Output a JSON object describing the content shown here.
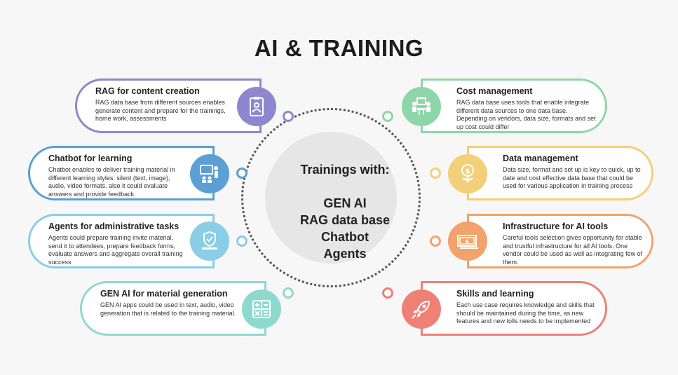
{
  "title": "AI & TRAINING",
  "center": {
    "heading": "Trainings with:",
    "items": [
      "GEN AI",
      "RAG data base",
      "Chatbot",
      "Agents"
    ]
  },
  "colors": {
    "purple": "#8e87cf",
    "blue": "#5b9fd4",
    "light_blue": "#89cde6",
    "teal": "#8fd8cd",
    "green": "#8ed6a9",
    "yellow": "#f2cf79",
    "orange": "#f1a36b",
    "red": "#ee8076"
  },
  "cards": {
    "rag": {
      "title": "RAG for content creation",
      "text": "RAG data base from different sources enables generate content and prepare for the trainings, home work, assessments",
      "icon": "clipboard-person-icon"
    },
    "chatbot": {
      "title": "Chatbot for learning",
      "text": "Chatbot enables to deliver training material in different learning styles: silent (text, image), audio, video formats. also it could evaluate answers and provide feedback",
      "icon": "presentation-icon"
    },
    "agents": {
      "title": "Agents for administrative tasks",
      "text": "Agents could prepare training invite material, send it to attendees, prepare feedback forms, evaluate answers and aggregate overall training success",
      "icon": "shield-laptop-icon"
    },
    "genai": {
      "title": "GEN AI for material generation",
      "text": "GEN AI apps could be used in text, audio, video generation that is related to the training material.",
      "icon": "calculator-icon"
    },
    "cost": {
      "title": "Cost management",
      "text": "RAG data base uses tools that enable integrate different data sources to one data base. Depending on vendors, data size, formats and set up cost could differ",
      "icon": "meeting-icon"
    },
    "data": {
      "title": "Data management",
      "text": "Data size, format and set up is key to quick, up to date and cost effective data base that could be used for various application in training process",
      "icon": "money-plant-icon"
    },
    "infra": {
      "title": "Infrastructure for AI tools",
      "text": "Careful tools selection gives opportunity for stable and trustful infrastructure for all AI tools. One vendor could be used as well as integrating few of them.",
      "icon": "banknote-icon"
    },
    "skills": {
      "title": "Skills and learning",
      "text": "Each use case requires knowledge and skills that should be maintained during the time, as new features and new tolls needs to be implemented",
      "icon": "rocket-icon"
    }
  }
}
